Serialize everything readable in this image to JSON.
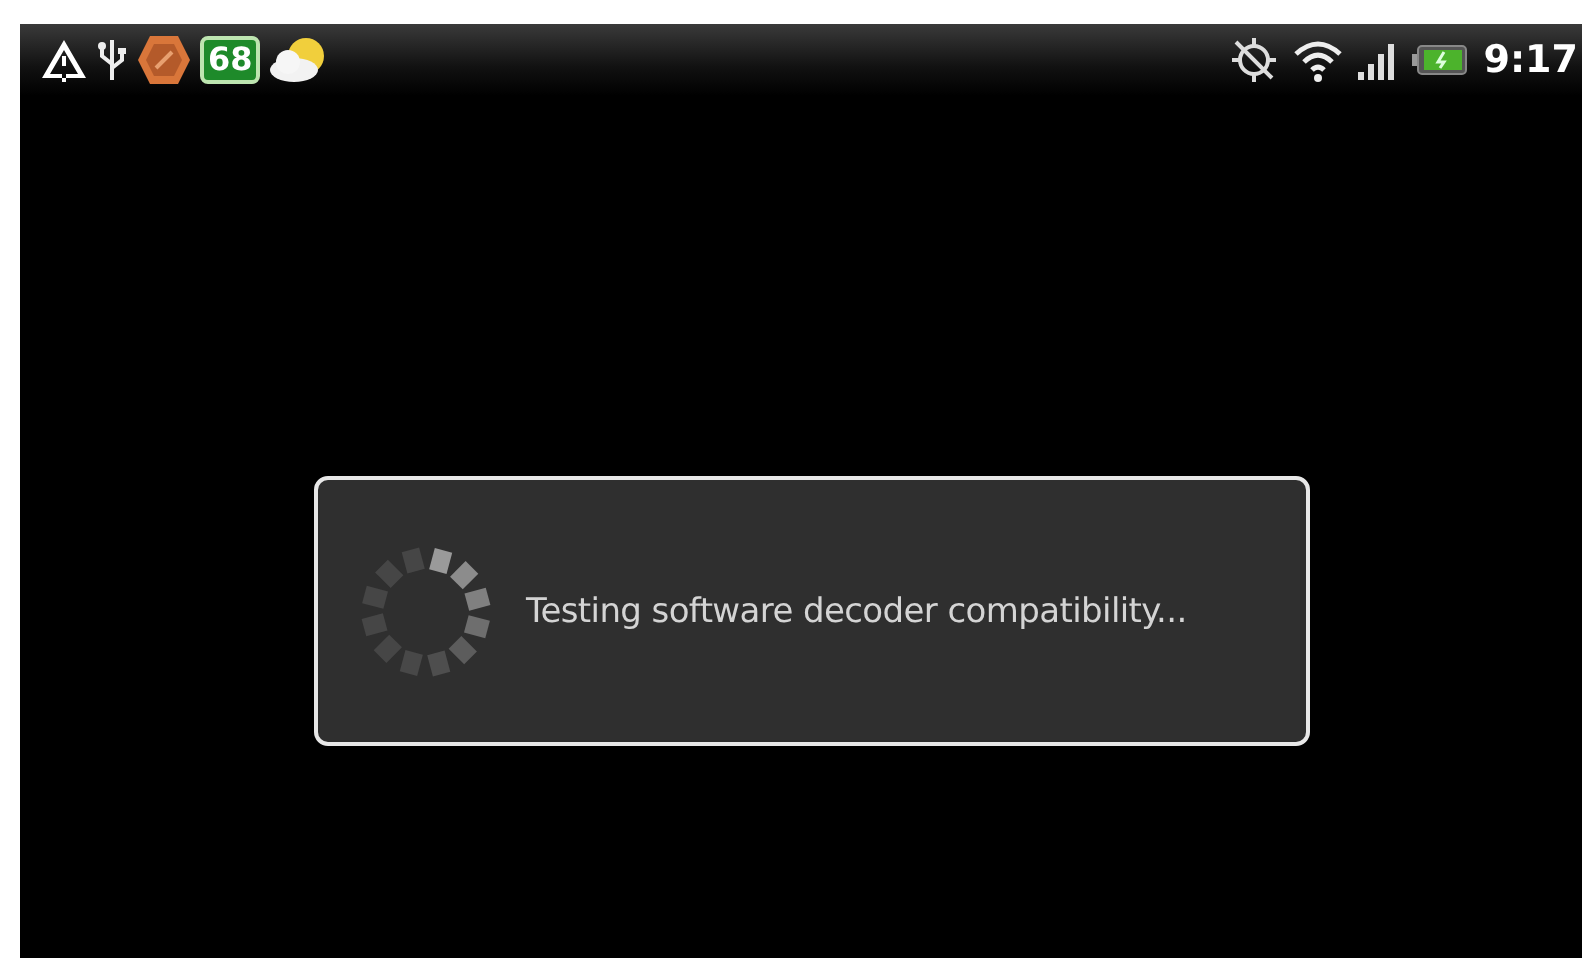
{
  "status_bar": {
    "notification_badge": "68",
    "time": "9:17"
  },
  "dialog": {
    "message": "Testing software decoder compatibility..."
  }
}
